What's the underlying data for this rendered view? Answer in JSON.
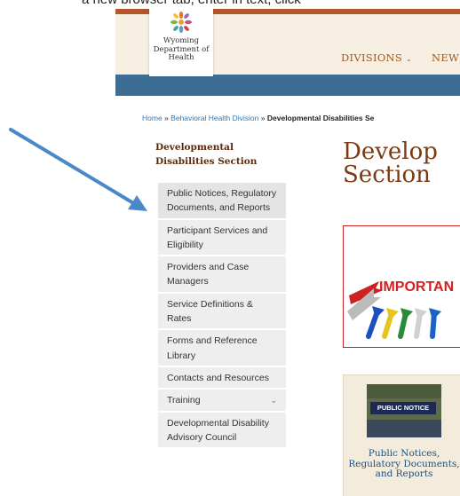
{
  "caption": "a new browser tab, enter in text, click",
  "header": {
    "org_name": "Wyoming Department of Health",
    "nav": {
      "divisions": "DIVISIONS",
      "news": "NEW"
    }
  },
  "breadcrumb": {
    "home": "Home",
    "sep1": "»",
    "division": "Behavioral Health Division",
    "sep2": "»",
    "current": "Developmental Disabilities Se"
  },
  "sidebar": {
    "title": "Developmental Disabilities Section",
    "items": [
      {
        "label": "Public Notices, Regulatory Documents, and Reports"
      },
      {
        "label": "Participant Services and Eligibility"
      },
      {
        "label": "Providers and Case Managers"
      },
      {
        "label": "Service Definitions & Rates"
      },
      {
        "label": "Forms and Reference Library"
      },
      {
        "label": "Contacts and Resources"
      },
      {
        "label": "Training"
      },
      {
        "label": "Developmental Disability Advisory Council"
      }
    ]
  },
  "main": {
    "title_line1": "Develop",
    "title_line2": "Section",
    "banner_text": "IMPORTAN",
    "card": {
      "thumb_text": "PUBLIC NOTICE",
      "label": "Public Notices, Regulatory Documents, and Reports"
    }
  },
  "colors": {
    "arrow": "#4a89c8",
    "brand_brown": "#b5562a",
    "nav_blue": "#3d6d93",
    "link_blue": "#2f7ab8"
  }
}
